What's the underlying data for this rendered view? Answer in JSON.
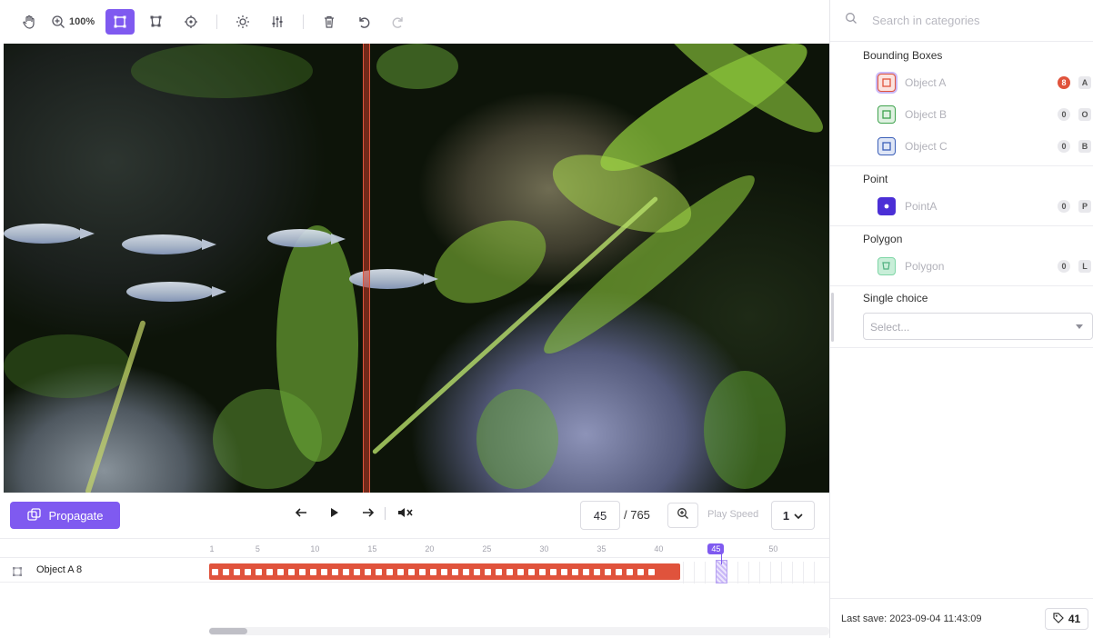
{
  "toolbar": {
    "zoom_level": "100%",
    "tools": [
      {
        "name": "hand-tool",
        "icon": "hand-icon"
      },
      {
        "name": "zoom-tool",
        "icon": "magnifier-plus-icon"
      },
      {
        "name": "bounding-box-tool",
        "icon": "bounding-box-icon",
        "active": true
      },
      {
        "name": "polygon-tool",
        "icon": "polygon-icon"
      },
      {
        "name": "point-tool",
        "icon": "crosshair-icon"
      },
      {
        "name": "brightness-tool",
        "icon": "sun-icon"
      },
      {
        "name": "adjustments-tool",
        "icon": "sliders-icon"
      },
      {
        "name": "delete-tool",
        "icon": "trash-icon"
      },
      {
        "name": "undo-tool",
        "icon": "undo-icon"
      },
      {
        "name": "redo-tool",
        "icon": "redo-icon",
        "disabled": true
      }
    ]
  },
  "controls": {
    "propagate_label": "Propagate",
    "current_frame": "45",
    "total_frames": "/ 765",
    "play_speed_label": "Play Speed",
    "play_speed_value": "1"
  },
  "timeline": {
    "ticks": [
      "1",
      "5",
      "10",
      "15",
      "20",
      "25",
      "30",
      "35",
      "40",
      "45",
      "50"
    ],
    "current_tick": "45",
    "tracks": [
      {
        "name": "Object A 8",
        "keyframe_count": 41
      }
    ]
  },
  "sidebar": {
    "search_placeholder": "Search in categories",
    "sections": [
      {
        "title": "Bounding Boxes",
        "items": [
          {
            "label": "Object A",
            "count": "8",
            "key": "A",
            "color": "#e0533c",
            "selected": true
          },
          {
            "label": "Object B",
            "count": "0",
            "key": "O",
            "color": "#3fa34d"
          },
          {
            "label": "Object C",
            "count": "0",
            "key": "B",
            "color": "#3b5fb8"
          }
        ]
      },
      {
        "title": "Point",
        "items": [
          {
            "label": "PointA",
            "count": "0",
            "key": "P",
            "color": "#4b2fd6"
          }
        ]
      },
      {
        "title": "Polygon",
        "items": [
          {
            "label": "Polygon",
            "count": "0",
            "key": "L",
            "color": "#7fd6a6"
          }
        ]
      },
      {
        "title": "Single choice",
        "select_placeholder": "Select..."
      }
    ],
    "footer": {
      "last_save": "Last save: 2023-09-04 11:43:09",
      "tag_count": "41"
    }
  }
}
